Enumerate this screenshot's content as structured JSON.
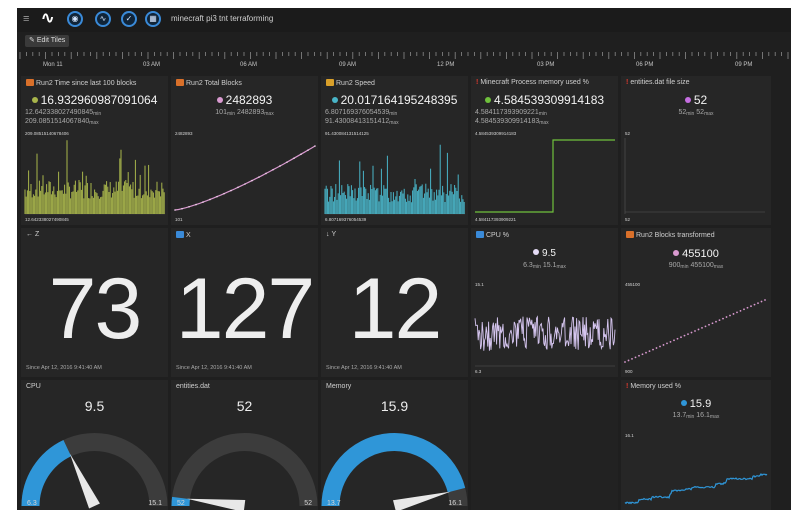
{
  "header": {
    "title": "minecraft pi3 tnt terraforming",
    "edit_label": "Edit Tiles"
  },
  "timeline": {
    "labels": [
      "Mon 11",
      "03 AM",
      "06 AM",
      "09 AM",
      "12 PM",
      "03 PM",
      "06 PM",
      "09 PM"
    ]
  },
  "tiles": {
    "run2_time": {
      "title": "Run2 Time since last 100 blocks",
      "value": "16.932960987091064",
      "min": "12.642338027490845",
      "max": "209.0851514067840",
      "min_sub": "min",
      "max_sub": "max",
      "axis_top": "209.08515140678406",
      "axis_bottom": "12.642338027490845",
      "color": "#a8b54b"
    },
    "run2_total": {
      "title": "Run2 Total Blocks",
      "value": "2482893",
      "min": "101",
      "max": "2482893",
      "min_sub": "min",
      "max_sub": "max",
      "axis_top": "2482893",
      "axis_bottom": "101",
      "color": "#d99ad0"
    },
    "run2_speed": {
      "title": "Run2 Speed",
      "value": "20.017164195248395",
      "min": "6.807169376054539",
      "max": "91.43008413151412",
      "min_sub": "min",
      "max_sub": "max",
      "axis_top": "91.430084131514125",
      "axis_bottom": "6.807169376054539",
      "color": "#49b5c8"
    },
    "mc_mem": {
      "title": "Minecraft Process memory used %",
      "value": "4.584539309914183",
      "min": "4.584117393909221",
      "max": "4.584539309914183",
      "min_sub": "min",
      "max_sub": "max",
      "axis_top": "4.584539309914183",
      "axis_bottom": "4.584117393909221",
      "color": "#6fc13c"
    },
    "entities_size": {
      "title": "entities.dat file size",
      "value": "52",
      "min": "52",
      "max": "52",
      "min_sub": "min",
      "max_sub": "max",
      "axis_top": "52",
      "axis_bottom": "52",
      "color": "#c56ee1"
    },
    "z": {
      "title": "Z",
      "value": "73",
      "since": "Since Apr 12, 2016 9:41:40 AM"
    },
    "x": {
      "title": "X",
      "value": "127",
      "since": "Since Apr 12, 2016 9:41:40 AM"
    },
    "y": {
      "title": "Y",
      "value": "12",
      "since": "Since Apr 12, 2016 9:41:40 AM"
    },
    "cpu_pct": {
      "title": "CPU %",
      "value": "9.5",
      "min": "6.3",
      "max": "15.1",
      "min_sub": "min",
      "max_sub": "max",
      "axis_top": "15.1",
      "axis_bottom": "6.3",
      "color": "#d6c6f0"
    },
    "blocks_transformed": {
      "title": "Run2 Blocks transformed",
      "value": "455100",
      "min": "900",
      "max": "455100",
      "min_sub": "min",
      "max_sub": "max",
      "axis_top": "455100",
      "axis_bottom": "900",
      "color": "#d99ad0"
    },
    "gauge_cpu": {
      "title": "CPU",
      "value": "9.5",
      "min": "6.3",
      "max": "15.1",
      "fill_fraction": 0.36,
      "color": "#2f96d8"
    },
    "gauge_entities": {
      "title": "entities.dat",
      "value": "52",
      "min": "52",
      "max": "52",
      "fill_fraction": 0.0,
      "color": "#2f96d8"
    },
    "gauge_memory": {
      "title": "Memory",
      "value": "15.9",
      "min": "13.7",
      "max": "16.1",
      "fill_fraction": 0.92,
      "color": "#2f96d8"
    },
    "mem_used": {
      "title": "Memory used %",
      "value": "15.9",
      "min": "13.7",
      "max": "16.1",
      "min_sub": "min",
      "max_sub": "max",
      "axis_top": "16.1",
      "axis_bottom": "",
      "color": "#2f96d8"
    }
  },
  "colors": {
    "background": "#1f1f1f",
    "tile": "#262626",
    "accent": "#2f96d8",
    "alert": "#e03a2f"
  }
}
